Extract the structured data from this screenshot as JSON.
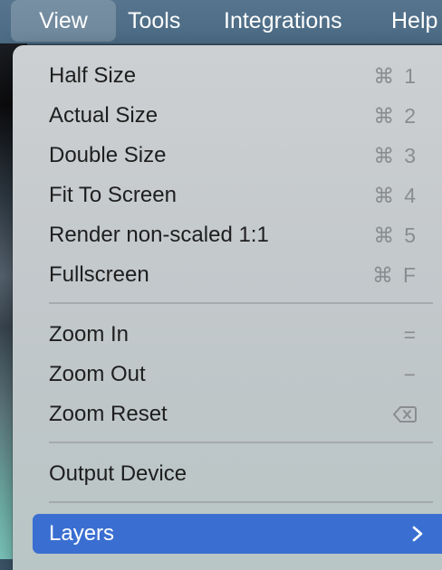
{
  "menubar": {
    "items": [
      {
        "label": "View"
      },
      {
        "label": "Tools"
      },
      {
        "label": "Integrations"
      },
      {
        "label": "Help"
      }
    ]
  },
  "view_menu": {
    "items": [
      {
        "label": "Half Size",
        "shortcut_glyph": "⌘",
        "shortcut_key": "1"
      },
      {
        "label": "Actual Size",
        "shortcut_glyph": "⌘",
        "shortcut_key": "2"
      },
      {
        "label": "Double Size",
        "shortcut_glyph": "⌘",
        "shortcut_key": "3"
      },
      {
        "label": "Fit To Screen",
        "shortcut_glyph": "⌘",
        "shortcut_key": "4"
      },
      {
        "label": "Render non-scaled 1:1",
        "shortcut_glyph": "⌘",
        "shortcut_key": "5"
      },
      {
        "label": "Fullscreen",
        "shortcut_glyph": "⌘",
        "shortcut_key": "F"
      },
      {
        "label": "Zoom In",
        "shortcut_key": "="
      },
      {
        "label": "Zoom Out",
        "shortcut_key": "−"
      },
      {
        "label": "Zoom Reset",
        "shortcut_icon": "delete-left-icon"
      },
      {
        "label": "Output Device"
      },
      {
        "label": "Layers",
        "submenu_icon": "chevron-right-icon"
      }
    ]
  },
  "colors": {
    "menubar_bg": "#4f6e87",
    "highlight": "#3a6fd1",
    "menu_text": "#1e1e1e",
    "shortcut_text": "#8a8d90"
  }
}
